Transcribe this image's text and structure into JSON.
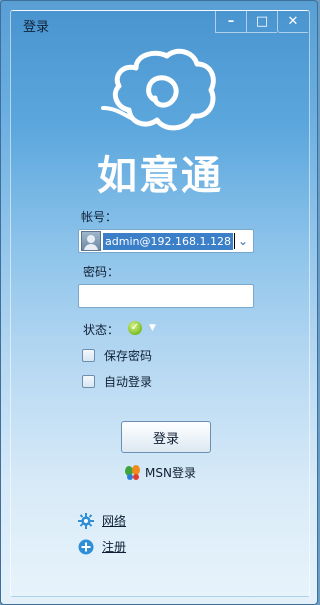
{
  "window": {
    "title": "登录",
    "minimize_glyph": "–",
    "maximize_glyph": "□",
    "close_glyph": "✕"
  },
  "brand": {
    "name": "如意通",
    "logo_icon": "cloud-swirl-icon"
  },
  "form": {
    "account_label": "帐号：",
    "account_value": "admin@192.168.1.128",
    "account_dropdown_icon": "chevron-down-icon",
    "password_label": "密码：",
    "password_value": "",
    "status_label": "状态：",
    "status_icon": "online-check-icon",
    "status_dropdown_glyph": "▼",
    "remember_password_label": "保存密码",
    "remember_password_checked": false,
    "auto_login_label": "自动登录",
    "auto_login_checked": false,
    "login_button_label": "登录",
    "msn_login_label": "MSN登录"
  },
  "links": {
    "network_label": "网络",
    "register_label": "注册"
  },
  "colors": {
    "accent": "#3c7fc9",
    "window_top": "#4a95d0",
    "window_bottom": "#e7f3fb"
  }
}
